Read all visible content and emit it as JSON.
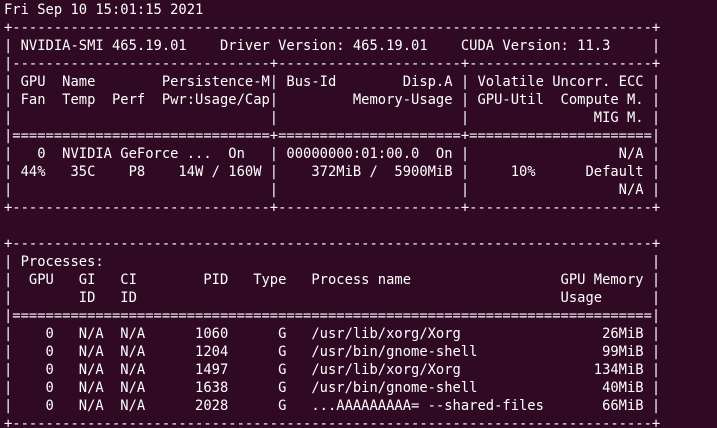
{
  "terminal": {
    "background": "#300a24",
    "foreground": "#ffffff",
    "lines": [
      "Fri Sep 10 15:01:15 2021",
      "+-----------------------------------------------------------------------------+",
      "| NVIDIA-SMI 465.19.01    Driver Version: 465.19.01    CUDA Version: 11.3     |",
      "|-------------------------------+----------------------+----------------------+",
      "| GPU  Name        Persistence-M| Bus-Id        Disp.A | Volatile Uncorr. ECC |",
      "| Fan  Temp  Perf  Pwr:Usage/Cap|         Memory-Usage | GPU-Util  Compute M. |",
      "|                               |                      |               MIG M. |",
      "|===============================+======================+======================|",
      "|   0  NVIDIA GeForce ...  On   | 00000000:01:00.0  On |                  N/A |",
      "| 44%   35C    P8    14W / 160W |    372MiB /  5900MiB |     10%      Default |",
      "|                               |                      |                  N/A |",
      "+-------------------------------+----------------------+----------------------+",
      "                                                                               ",
      "+-----------------------------------------------------------------------------+",
      "| Processes:                                                                  |",
      "|  GPU   GI   CI        PID   Type   Process name                  GPU Memory |",
      "|        ID   ID                                                   Usage      |",
      "|=============================================================================|",
      "|    0   N/A  N/A      1060      G   /usr/lib/xorg/Xorg                 26MiB |",
      "|    0   N/A  N/A      1204      G   /usr/bin/gnome-shell               99MiB |",
      "|    0   N/A  N/A      1497      G   /usr/lib/xorg/Xorg                134MiB |",
      "|    0   N/A  N/A      1638      G   /usr/bin/gnome-shell               40MiB |",
      "|    0   N/A  N/A      2028      G   ...AAAAAAAAA= --shared-files       66MiB |",
      "+-----------------------------------------------------------------------------+"
    ]
  }
}
